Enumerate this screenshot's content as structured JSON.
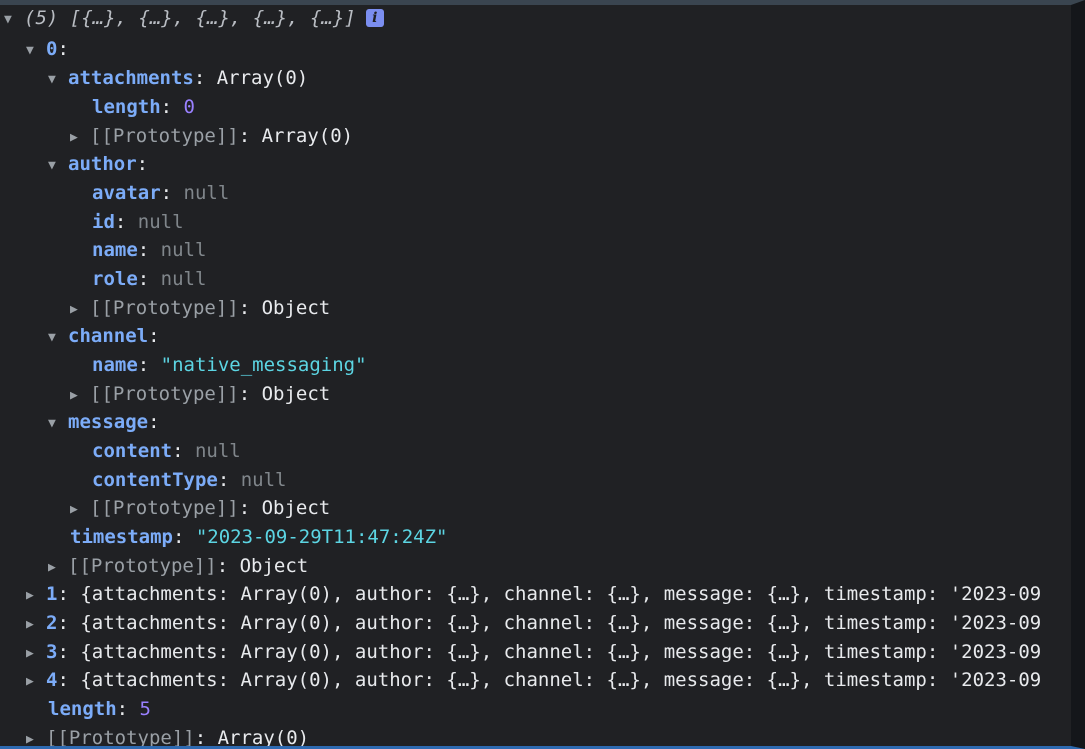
{
  "header": {
    "summary": "(5) [{…}, {…}, {…}, {…}, {…}]",
    "info_icon": "i"
  },
  "item0": {
    "index": "0",
    "attachments": {
      "key": "attachments",
      "value": "Array(0)",
      "length_key": "length",
      "length_value": "0",
      "proto_key": "[[Prototype]]",
      "proto_value": "Array(0)"
    },
    "author": {
      "key": "author",
      "fields": [
        {
          "key": "avatar",
          "value": "null"
        },
        {
          "key": "id",
          "value": "null"
        },
        {
          "key": "name",
          "value": "null"
        },
        {
          "key": "role",
          "value": "null"
        }
      ],
      "proto_key": "[[Prototype]]",
      "proto_value": "Object"
    },
    "channel": {
      "key": "channel",
      "name_key": "name",
      "name_value": "\"native_messaging\"",
      "proto_key": "[[Prototype]]",
      "proto_value": "Object"
    },
    "message": {
      "key": "message",
      "fields": [
        {
          "key": "content",
          "value": "null"
        },
        {
          "key": "contentType",
          "value": "null"
        }
      ],
      "proto_key": "[[Prototype]]",
      "proto_value": "Object"
    },
    "timestamp": {
      "key": "timestamp",
      "value": "\"2023-09-29T11:47:24Z\""
    },
    "proto_key": "[[Prototype]]",
    "proto_value": "Object"
  },
  "rows": [
    {
      "index": "1",
      "preview": "{attachments: Array(0), author: {…}, channel: {…}, message: {…}, timestamp: '2023-09"
    },
    {
      "index": "2",
      "preview": "{attachments: Array(0), author: {…}, channel: {…}, message: {…}, timestamp: '2023-09"
    },
    {
      "index": "3",
      "preview": "{attachments: Array(0), author: {…}, channel: {…}, message: {…}, timestamp: '2023-09"
    },
    {
      "index": "4",
      "preview": "{attachments: Array(0), author: {…}, channel: {…}, message: {…}, timestamp: '2023-09"
    }
  ],
  "footer": {
    "length_key": "length",
    "length_value": "5",
    "proto_key": "[[Prototype]]",
    "proto_value": "Array(0)"
  },
  "colors": {
    "key": "#7cacf8",
    "string": "#5cd5e3",
    "number": "#9980ff",
    "null": "#80868b",
    "background": "#202124"
  }
}
